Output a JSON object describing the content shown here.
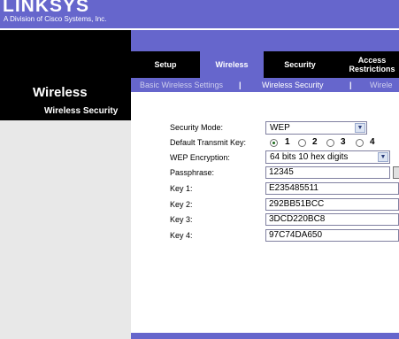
{
  "header": {
    "logo": "LINKSYS",
    "logo_sub": "A Division of Cisco Systems, Inc."
  },
  "section_title": "Wireless",
  "tabs": [
    {
      "label": "Setup"
    },
    {
      "label": "Wireless",
      "active": true
    },
    {
      "label": "Security"
    },
    {
      "label": "Access Restrictions"
    }
  ],
  "subtabs": {
    "basic": "Basic Wireless Settings",
    "separator": "|",
    "security": "Wireless Security",
    "more": "Wirele"
  },
  "left_panel": {
    "title": "Wireless Security"
  },
  "form": {
    "security_mode": {
      "label": "Security Mode:",
      "value": "WEP"
    },
    "default_transmit_key": {
      "label": "Default Transmit  Key:",
      "options": [
        "1",
        "2",
        "3",
        "4"
      ],
      "selected": "1"
    },
    "wep_encryption": {
      "label": "WEP Encryption:",
      "value": "64 bits 10 hex digits"
    },
    "passphrase": {
      "label": "Passphrase:",
      "value": "12345"
    },
    "key1": {
      "label": "Key 1:",
      "value": "E235485511"
    },
    "key2": {
      "label": "Key 2:",
      "value": "292BB51BCC"
    },
    "key3": {
      "label": "Key 3:",
      "value": "3DCD220BC8"
    },
    "key4": {
      "label": "Key 4:",
      "value": "97C74DA650"
    }
  },
  "colors": {
    "brand_purple": "#6666cc",
    "nav_black": "#000000",
    "panel_gray": "#e8e8e8"
  }
}
